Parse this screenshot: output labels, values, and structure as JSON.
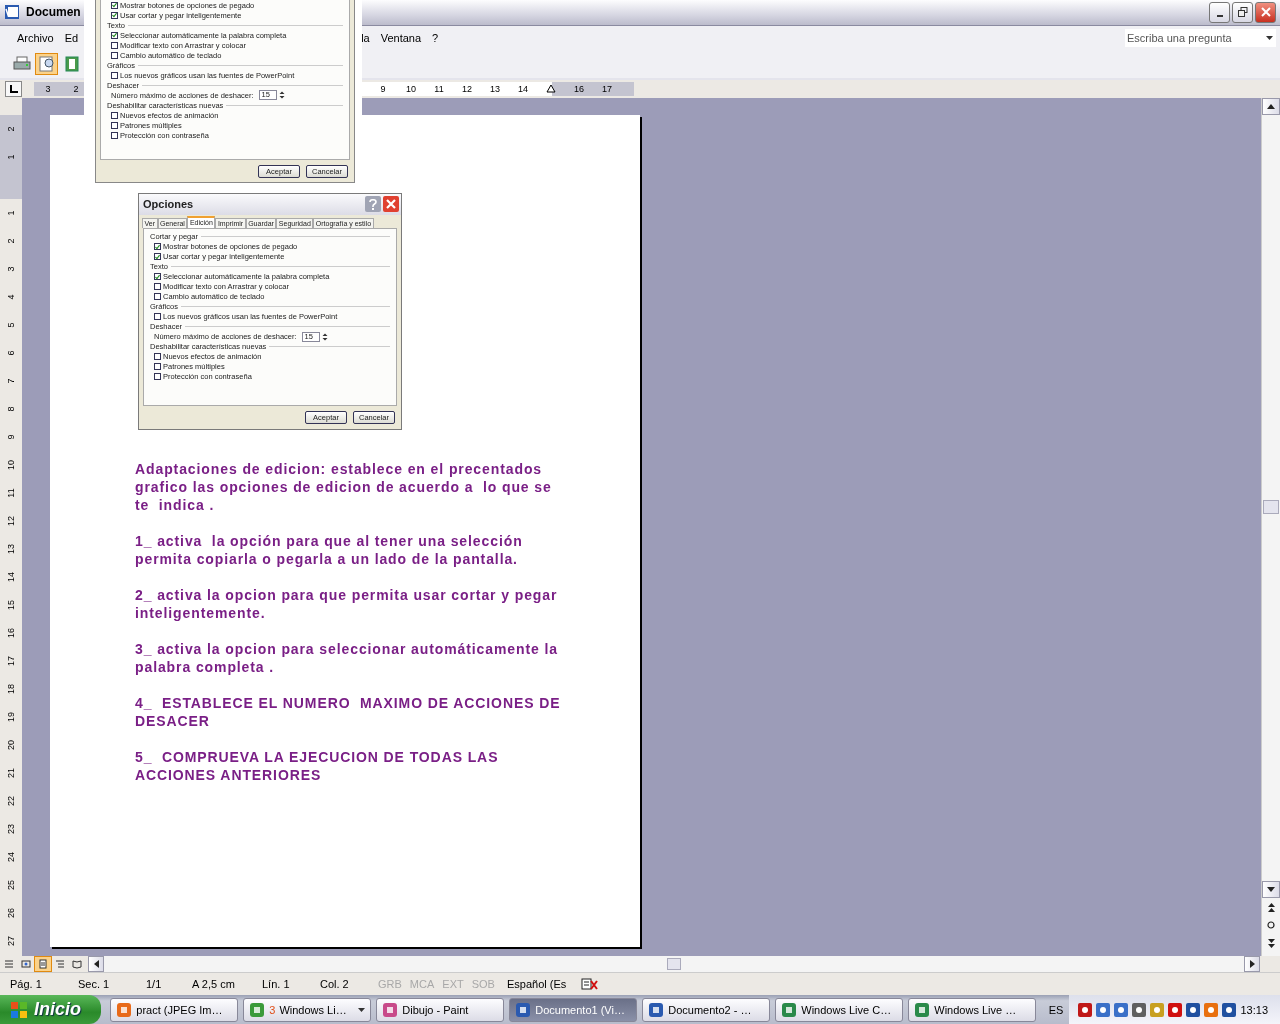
{
  "window": {
    "title": "Documen",
    "menu": [
      {
        "label": "Archivo"
      },
      {
        "label": "Ed"
      },
      {
        "label": "la"
      },
      {
        "label": "Ventana"
      },
      {
        "label": "?"
      }
    ],
    "help_search": {
      "placeholder": "Escriba una pregunta"
    }
  },
  "horizontal_ruler": {
    "left_labels": [
      "3",
      "2"
    ],
    "right_labels": [
      "9",
      "10",
      "11",
      "12",
      "13",
      "14"
    ],
    "after_indent_labels": [
      "16",
      "17"
    ]
  },
  "vertical_ruler": {
    "top_margin_labels": [
      "2",
      "1"
    ],
    "labels": [
      "1",
      "2",
      "3",
      "4",
      "5",
      "6",
      "7",
      "8",
      "9",
      "10",
      "11",
      "12",
      "13",
      "14",
      "15",
      "16",
      "17",
      "18",
      "19",
      "20",
      "21",
      "22",
      "23",
      "24",
      "25",
      "26",
      "27"
    ]
  },
  "pasted_dialogs": [
    {
      "sections": [
        {
          "items": [
            {
              "kind": "checkbox",
              "label": "Mostrar botones de opciones de pegado",
              "checked": true
            },
            {
              "kind": "checkbox",
              "label": "Usar cortar y pegar inteligentemente",
              "checked": true
            }
          ]
        },
        {
          "heading": "Texto",
          "items": [
            {
              "kind": "checkbox",
              "label": "Seleccionar automáticamente la palabra completa",
              "checked": true
            },
            {
              "kind": "checkbox",
              "label": "Modificar texto con Arrastrar y colocar",
              "checked": false
            },
            {
              "kind": "checkbox",
              "label": "Cambio automático de teclado",
              "checked": false
            }
          ]
        },
        {
          "heading": "Gráficos",
          "items": [
            {
              "kind": "checkbox",
              "label": "Los nuevos gráficos usan las fuentes de PowerPoint",
              "checked": false
            }
          ]
        },
        {
          "heading": "Deshacer",
          "items": [
            {
              "kind": "spin",
              "label": "Número máximo de acciones de deshacer:",
              "value": "15"
            }
          ]
        },
        {
          "heading": "Deshabilitar características nuevas",
          "items": [
            {
              "kind": "checkbox",
              "label": "Nuevos efectos de animación",
              "checked": false
            },
            {
              "kind": "checkbox",
              "label": "Patrones múltiples",
              "checked": false
            },
            {
              "kind": "checkbox",
              "label": "Protección con contraseña",
              "checked": false
            }
          ]
        }
      ],
      "buttons": [
        "Aceptar",
        "Cancelar"
      ]
    },
    {
      "title": "Opciones",
      "tabs": [
        {
          "label": "Ver",
          "selected": false
        },
        {
          "label": "General",
          "selected": false
        },
        {
          "label": "Edición",
          "selected": true
        },
        {
          "label": "Imprimir",
          "selected": false
        },
        {
          "label": "Guardar",
          "selected": false
        },
        {
          "label": "Seguridad",
          "selected": false
        },
        {
          "label": "Ortografía y estilo",
          "selected": false
        }
      ],
      "sections": [
        {
          "heading": "Cortar y pegar",
          "items": [
            {
              "kind": "checkbox",
              "label": "Mostrar botones de opciones de pegado",
              "checked": true
            },
            {
              "kind": "checkbox",
              "label": "Usar cortar y pegar inteligentemente",
              "checked": true
            }
          ]
        },
        {
          "heading": "Texto",
          "items": [
            {
              "kind": "checkbox",
              "label": "Seleccionar automáticamente la palabra completa",
              "checked": true
            },
            {
              "kind": "checkbox",
              "label": "Modificar texto con Arrastrar y colocar",
              "checked": false
            },
            {
              "kind": "checkbox",
              "label": "Cambio automático de teclado",
              "checked": false
            }
          ]
        },
        {
          "heading": "Gráficos",
          "items": [
            {
              "kind": "checkbox",
              "label": "Los nuevos gráficos usan las fuentes de PowerPoint",
              "checked": false
            }
          ]
        },
        {
          "heading": "Deshacer",
          "items": [
            {
              "kind": "spin",
              "label": "Número máximo de acciones de deshacer:",
              "value": "15"
            }
          ]
        },
        {
          "heading": "Deshabilitar características nuevas",
          "items": [
            {
              "kind": "checkbox",
              "label": "Nuevos efectos de animación",
              "checked": false
            },
            {
              "kind": "checkbox",
              "label": "Patrones múltiples",
              "checked": false
            },
            {
              "kind": "checkbox",
              "label": "Protección con contraseña",
              "checked": false
            }
          ]
        }
      ],
      "buttons": [
        "Aceptar",
        "Cancelar"
      ]
    }
  ],
  "document": {
    "paragraphs": [
      "Adaptaciones de edicion: establece en el precentados grafico las opciones de edicion de acuerdo a  lo que se te  indica .",
      "1_ activa  la opción para que al tener una selección permita copiarla o pegarla a un lado de la pantalla.",
      "2_ activa la opcion para que permita usar cortar y pegar inteligentemente.",
      "3_ activa la opcion para seleccionar automáticamente la palabra completa .",
      "4_  ESTABLECE EL NUMERO  MAXIMO DE ACCIONES DE DESACER",
      "5_  COMPRUEVA LA EJECUCION DE TODAS LAS ACCIONES ANTERIORES"
    ]
  },
  "status_bar": {
    "items": [
      {
        "text": "Pág. 1",
        "disabled": false
      },
      {
        "text": "Sec. 1",
        "disabled": false
      },
      {
        "text": "1/1",
        "disabled": false
      },
      {
        "text": "A 2,5 cm",
        "disabled": false
      },
      {
        "text": "Lín. 1",
        "disabled": false
      },
      {
        "text": "Col. 2",
        "disabled": false
      },
      {
        "text": "GRB",
        "disabled": true
      },
      {
        "text": "MCA",
        "disabled": true
      },
      {
        "text": "EXT",
        "disabled": true
      },
      {
        "text": "SOB",
        "disabled": true
      },
      {
        "text": "Español (Es",
        "disabled": false
      }
    ]
  },
  "taskbar": {
    "start": "Inicio",
    "tasks": [
      {
        "label": "pract (JPEG Im…",
        "selected": false
      },
      {
        "label": "Windows Li…",
        "count": "3",
        "grouped": true,
        "selected": false
      },
      {
        "label": "Dibujo - Paint",
        "selected": false
      },
      {
        "label": "Documento1 (Vi…",
        "selected": true
      },
      {
        "label": "Documento2 - …",
        "selected": false
      },
      {
        "label": "Windows Live C…",
        "selected": false
      },
      {
        "label": "Windows Live …",
        "selected": false
      }
    ],
    "language": "ES",
    "clock": "13:13"
  }
}
